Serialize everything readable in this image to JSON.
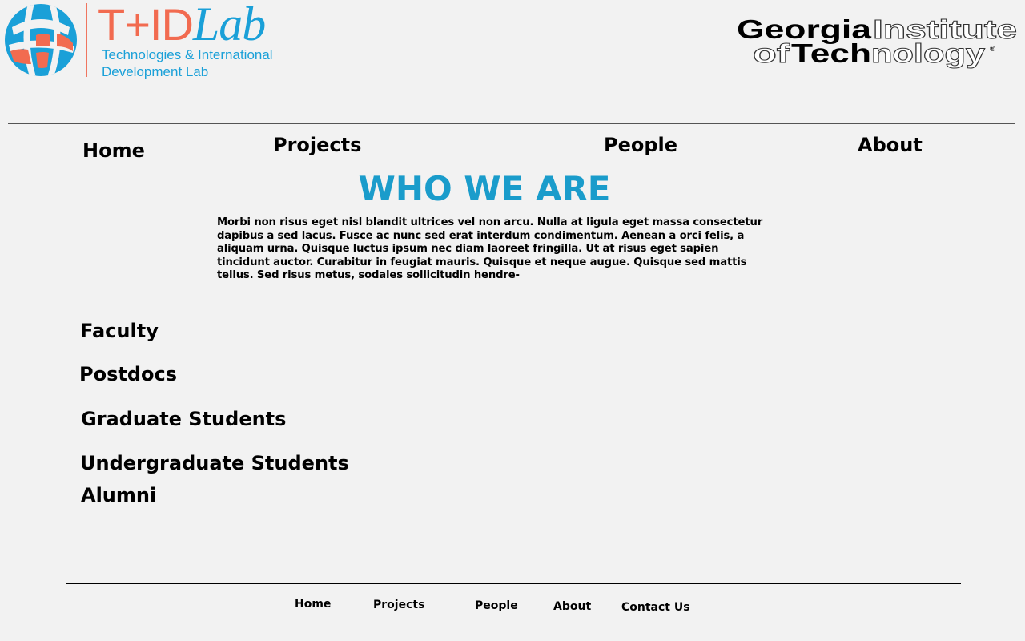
{
  "header": {
    "logo_main": "T+ID",
    "logo_lab": "Lab",
    "logo_sub_line1": "Technologies & International",
    "logo_sub_line2": "Development Lab",
    "institution_line1_bold": "Georgia",
    "institution_line1_outline": "Institute",
    "institution_line2_outline_a": "of",
    "institution_line2_bold": "Tech",
    "institution_line2_outline_b": "nology",
    "institution_reg": "®"
  },
  "nav": {
    "home": "Home",
    "projects": "Projects",
    "people": "People",
    "about": "About"
  },
  "main": {
    "heading": "WHO WE ARE",
    "body": "Morbi non risus eget nisl blandit ultrices vel non arcu. Nulla at ligula eget massa consectetur dapibus a sed lacus. Fusce ac nunc sed erat interdum condimentum. Aenean a orci felis, a aliquam urna. Quisque luctus ipsum nec diam laoreet fringilla. Ut at risus eget sapien tincidunt auctor. Curabitur in feugiat mauris. Quisque et neque augue. Quisque sed mattis tellus. Sed risus metus, sodales sollicitudin hendre-"
  },
  "people": {
    "faculty": "Faculty",
    "postdocs": "Postdocs",
    "graduate": "Graduate Students",
    "undergraduate": "Undergraduate Students",
    "alumni": "Alumni"
  },
  "footer": {
    "home": "Home",
    "projects": "Projects",
    "people": "People",
    "about": "About",
    "contact": "Contact Us"
  },
  "colors": {
    "background": "#f2f2f2",
    "accent_blue": "#1a9ccb",
    "logo_orange": "#f26b50"
  }
}
